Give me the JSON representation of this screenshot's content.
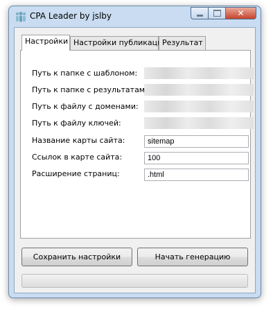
{
  "window": {
    "title": "CPA Leader by jslby",
    "icon": "people-icon",
    "controls": [
      "minimize-icon",
      "maximize-icon",
      "close-icon"
    ]
  },
  "tabs": [
    {
      "label": "Настройки",
      "active": true
    },
    {
      "label": "Настройки публикации",
      "active": false
    },
    {
      "label": "Результат",
      "active": false
    }
  ],
  "settings": {
    "template_folder_label": "Путь к папке с шаблоном:",
    "results_folder_label": "Путь к папке с результатами:",
    "domains_file_label": "Путь к файлу с доменами:",
    "keys_file_label": "Путь к файлу ключей:",
    "sitemap_name_label": "Название карты сайта:",
    "sitemap_name_value": "sitemap",
    "sitemap_links_label": "Ссылок в карте сайта:",
    "sitemap_links_value": "100",
    "page_extension_label": "Расширение страниц:",
    "page_extension_value": ".html"
  },
  "buttons": {
    "save": "Сохранить настройки",
    "generate": "Начать генерацию"
  },
  "progress": {
    "value": 0
  },
  "colors": {
    "frame": "#c9dcf1",
    "close_button": "#c6452c",
    "progress_fill": "#06b025"
  }
}
